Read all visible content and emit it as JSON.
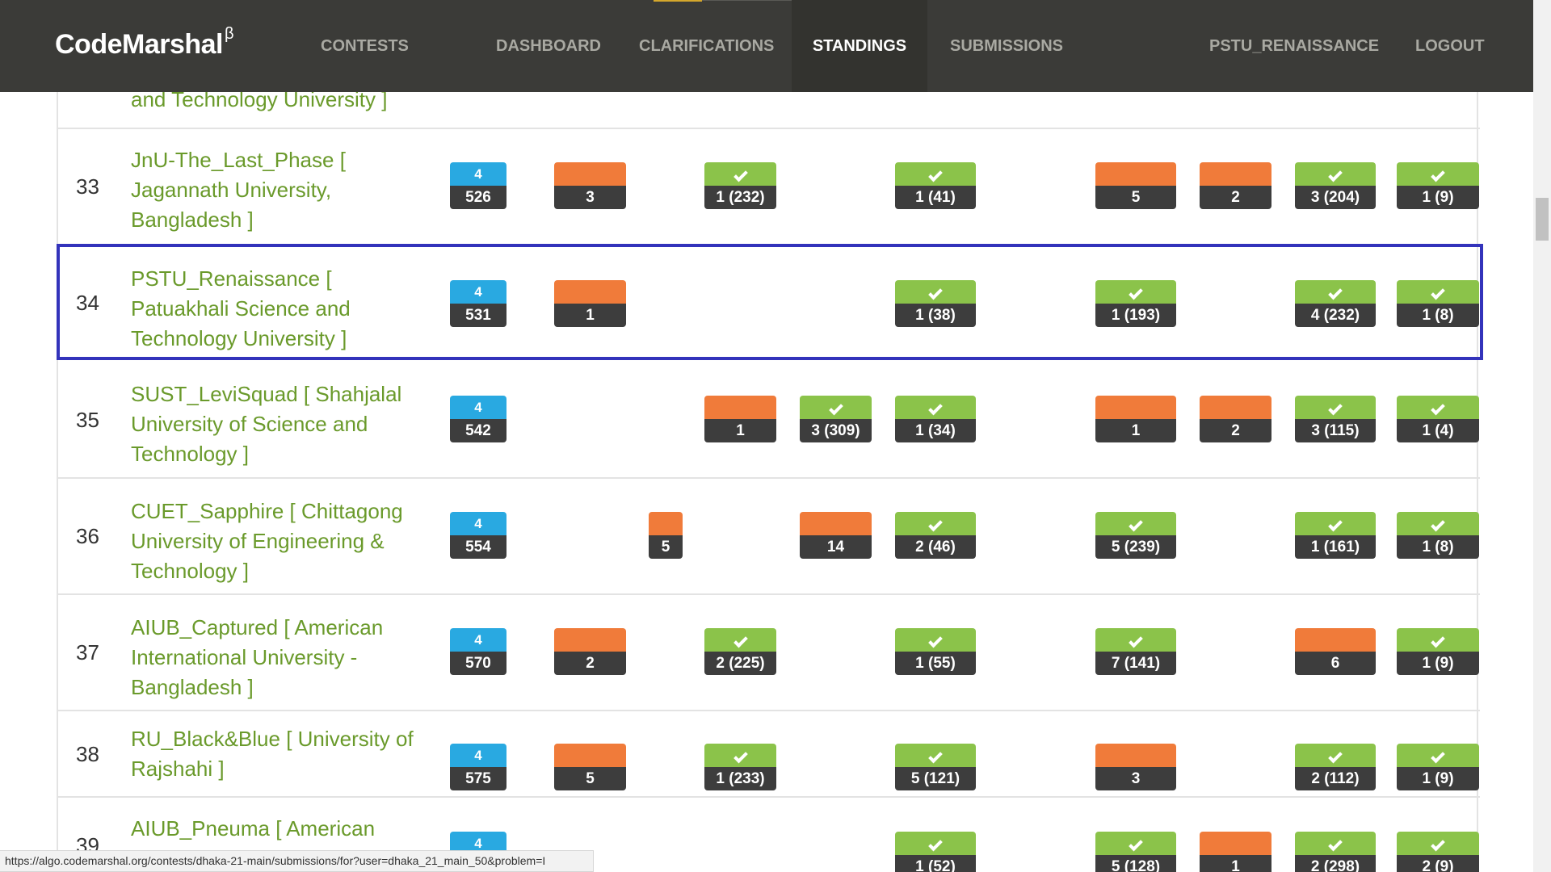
{
  "brand": {
    "name": "CodeMarshal",
    "beta": "β"
  },
  "nav": {
    "contests": "CONTESTS",
    "dashboard": "DASHBOARD",
    "clarifications": "CLARIFICATIONS",
    "standings": "STANDINGS",
    "submissions": "SUBMISSIONS",
    "user": "PSTU_RENAISSANCE",
    "logout": "LOGOUT"
  },
  "top_partial_row": {
    "team_tail": "and Technology University ]"
  },
  "rows": [
    {
      "rank": "33",
      "team": "JnU-The_Last_Phase [ Jagannath University, Bangladesh ]",
      "solved": "4",
      "penalty": "526",
      "cells": [
        {
          "col": "B",
          "status": "tried",
          "value": "3"
        },
        {
          "col": "D",
          "status": "solved",
          "value": "1 (232)"
        },
        {
          "col": "F",
          "status": "solved",
          "value": "1 (41)"
        },
        {
          "col": "H",
          "status": "tried",
          "value": "5"
        },
        {
          "col": "I",
          "status": "tried",
          "value": "2"
        },
        {
          "col": "J",
          "status": "solved",
          "value": "3 (204)"
        },
        {
          "col": "K",
          "status": "solved",
          "value": "1 (9)"
        }
      ]
    },
    {
      "rank": "34",
      "team": "PSTU_Renaissance [ Patuakhali Science and Technology University ]",
      "solved": "4",
      "penalty": "531",
      "cells": [
        {
          "col": "B",
          "status": "tried",
          "value": "1"
        },
        {
          "col": "F",
          "status": "solved",
          "value": "1 (38)"
        },
        {
          "col": "H",
          "status": "solved",
          "value": "1 (193)"
        },
        {
          "col": "J",
          "status": "solved",
          "value": "4 (232)"
        },
        {
          "col": "K",
          "status": "solved",
          "value": "1 (8)"
        }
      ]
    },
    {
      "rank": "35",
      "team": "SUST_LeviSquad [ Shahjalal University of Science and Technology ]",
      "solved": "4",
      "penalty": "542",
      "cells": [
        {
          "col": "D",
          "status": "tried",
          "value": "1"
        },
        {
          "col": "E",
          "status": "solved",
          "value": "3 (309)"
        },
        {
          "col": "F",
          "status": "solved",
          "value": "1 (34)"
        },
        {
          "col": "H",
          "status": "tried",
          "value": "1"
        },
        {
          "col": "I",
          "status": "tried",
          "value": "2"
        },
        {
          "col": "J",
          "status": "solved",
          "value": "3 (115)"
        },
        {
          "col": "K",
          "status": "solved",
          "value": "1 (4)"
        }
      ]
    },
    {
      "rank": "36",
      "team": "CUET_Sapphire [ Chittagong University of Engineering & Technology ]",
      "solved": "4",
      "penalty": "554",
      "cells": [
        {
          "col": "C",
          "status": "tried",
          "value": "5"
        },
        {
          "col": "E",
          "status": "tried",
          "value": "14"
        },
        {
          "col": "F",
          "status": "solved",
          "value": "2 (46)"
        },
        {
          "col": "H",
          "status": "solved",
          "value": "5 (239)"
        },
        {
          "col": "J",
          "status": "solved",
          "value": "1 (161)"
        },
        {
          "col": "K",
          "status": "solved",
          "value": "1 (8)"
        }
      ]
    },
    {
      "rank": "37",
      "team": "AIUB_Captured [ American International University - Bangladesh ]",
      "solved": "4",
      "penalty": "570",
      "cells": [
        {
          "col": "B",
          "status": "tried",
          "value": "2"
        },
        {
          "col": "D",
          "status": "solved",
          "value": "2 (225)"
        },
        {
          "col": "F",
          "status": "solved",
          "value": "1 (55)"
        },
        {
          "col": "H",
          "status": "solved",
          "value": "7 (141)"
        },
        {
          "col": "J",
          "status": "tried",
          "value": "6"
        },
        {
          "col": "K",
          "status": "solved",
          "value": "1 (9)"
        }
      ]
    },
    {
      "rank": "38",
      "team": "RU_Black&Blue [ University of Rajshahi ]",
      "solved": "4",
      "penalty": "575",
      "cells": [
        {
          "col": "B",
          "status": "tried",
          "value": "5"
        },
        {
          "col": "D",
          "status": "solved",
          "value": "1 (233)"
        },
        {
          "col": "F",
          "status": "solved",
          "value": "5 (121)"
        },
        {
          "col": "H",
          "status": "tried",
          "value": "3"
        },
        {
          "col": "J",
          "status": "solved",
          "value": "2 (112)"
        },
        {
          "col": "K",
          "status": "solved",
          "value": "1 (9)"
        }
      ]
    },
    {
      "rank": "39",
      "team": "AIUB_Pneuma [ American International University",
      "solved": "4",
      "penalty": "",
      "cells": [
        {
          "col": "F",
          "status": "solved",
          "value": "1 (52)"
        },
        {
          "col": "H",
          "status": "solved",
          "value": "5 (128)"
        },
        {
          "col": "I",
          "status": "tried",
          "value": "1"
        },
        {
          "col": "J",
          "status": "solved",
          "value": "2 (298)"
        },
        {
          "col": "K",
          "status": "solved",
          "value": "2 (9)"
        }
      ]
    }
  ],
  "statusbar": {
    "url": "https://algo.codemarshal.org/contests/dhaka-21-main/submissions/for?user=dhaka_21_main_50&problem=I"
  }
}
